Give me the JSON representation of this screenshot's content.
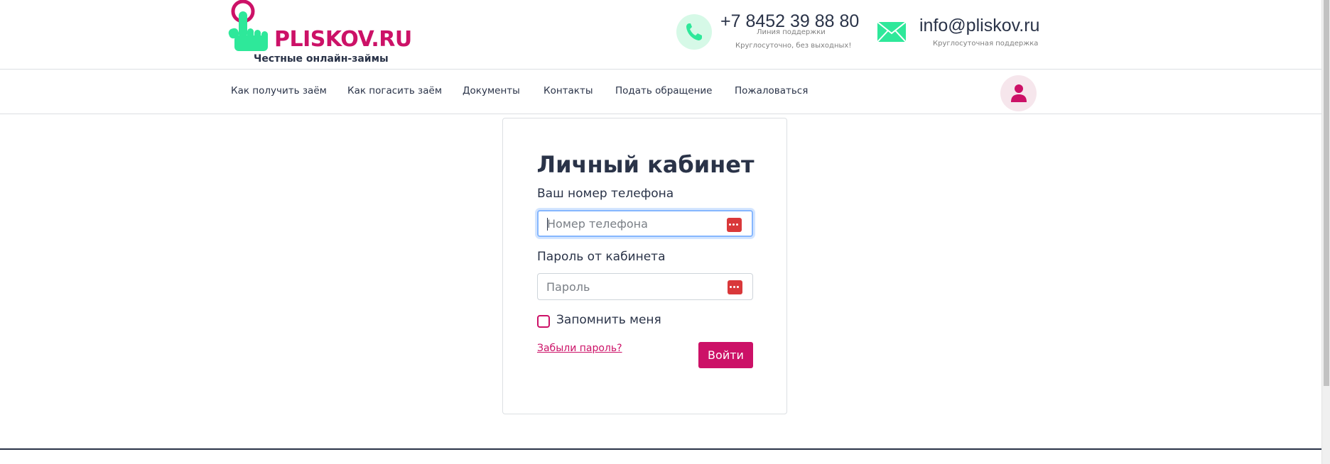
{
  "header": {
    "logo_text": "PLISKOV.RU",
    "tagline": "Честные онлайн-займы",
    "phone": {
      "number": "+7 8452 39 88 80",
      "line": "Линия поддержки",
      "hours": "Круглосуточно, без выходных!"
    },
    "email": {
      "address": "info@pliskov.ru",
      "note": "Круглосуточная поддержка"
    }
  },
  "nav": {
    "items": [
      {
        "label": "Как получить заём"
      },
      {
        "label": "Как погасить заём"
      },
      {
        "label": "Документы"
      },
      {
        "label": "Контакты"
      },
      {
        "label": "Подать обращение"
      },
      {
        "label": "Пожаловаться"
      }
    ]
  },
  "login": {
    "title": "Личный кабинет",
    "phone_label": "Ваш номер телефона",
    "phone_placeholder": "Номер телефона",
    "password_label": "Пароль от кабинета",
    "password_placeholder": "Пароль",
    "remember_label": "Запомнить меня",
    "forgot_link": "Забыли пароль?",
    "submit_label": "Войти"
  },
  "icons": {
    "logo": "pointing-hand-icon",
    "phone": "phone-icon",
    "email": "envelope-icon",
    "user": "user-icon",
    "password_manager": "password-manager-icon"
  },
  "colors": {
    "brand": "#cc1167",
    "accent_green": "#2ee89a",
    "text": "#2a3348"
  }
}
